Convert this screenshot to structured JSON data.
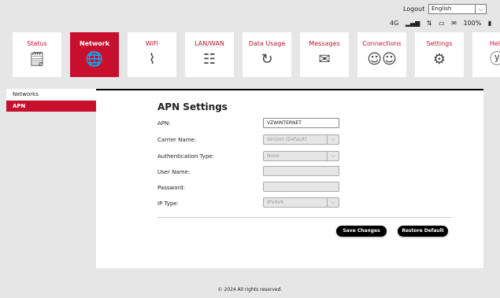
{
  "header": {
    "logout_label": "Logout",
    "language": {
      "selected": "English"
    },
    "status_icons": [
      "4G",
      "signal-icon",
      "data-arrows-icon",
      "screen-icon",
      "message-icon",
      "100%",
      "battery-icon"
    ],
    "network_text": "4G",
    "battery_text": "100%"
  },
  "nav": {
    "items": [
      {
        "label": "Status",
        "icon": "status-icon"
      },
      {
        "label": "Network",
        "icon": "globe-icon"
      },
      {
        "label": "WiFi",
        "icon": "wifi-icon"
      },
      {
        "label": "LAN/WAN",
        "icon": "network-icon"
      },
      {
        "label": "Data Usage",
        "icon": "data-usage-icon"
      },
      {
        "label": "Messages",
        "icon": "envelope-icon"
      },
      {
        "label": "Connections",
        "icon": "users-icon"
      },
      {
        "label": "Settings",
        "icon": "gear-icon"
      },
      {
        "label": "Help",
        "icon": "help-icon"
      }
    ]
  },
  "sidebar": {
    "items": [
      {
        "label": "Networks"
      },
      {
        "label": "APN"
      }
    ]
  },
  "form": {
    "title": "APN Settings",
    "apn_label": "APN:",
    "apn_value": "VZWINTERNET",
    "carrier_label": "Carrier Name:",
    "carrier_value": "Verizon (Default)",
    "auth_label": "Authentication Type:",
    "auth_value": "None",
    "user_label": "User Name:",
    "user_value": "",
    "password_label": "Password:",
    "password_value": "",
    "ip_label": "IP Type:",
    "ip_value": "IPV4V6",
    "save_label": "Save Changes",
    "restore_label": "Restore Default"
  },
  "footer": {
    "text": "© 2024 All rights reserved."
  },
  "colors": {
    "accent": "#c8102e",
    "page_bg": "#e6e6e6",
    "button": "#000000"
  }
}
